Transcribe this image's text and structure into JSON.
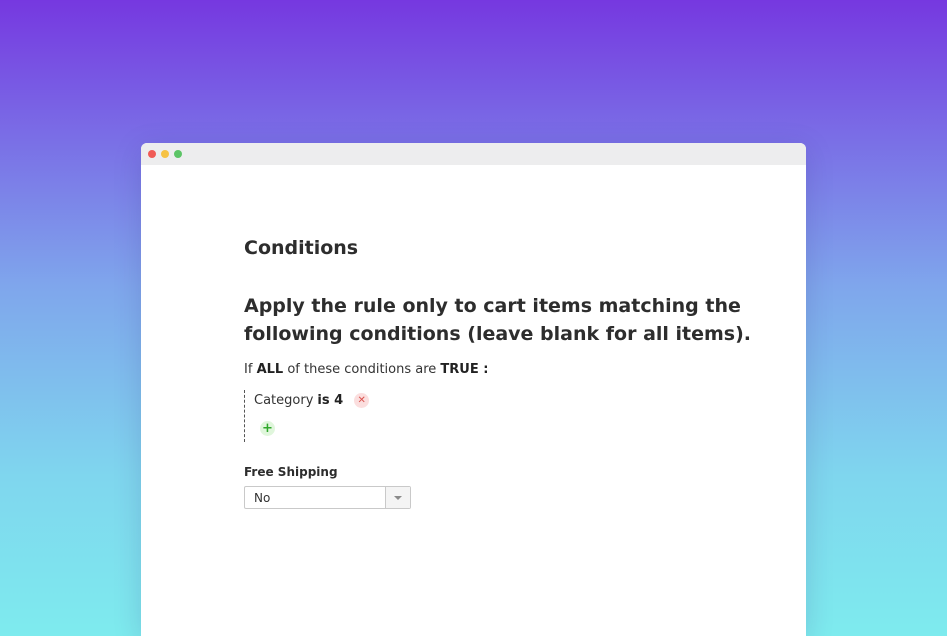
{
  "window": {
    "controls": [
      "close",
      "minimize",
      "maximize"
    ]
  },
  "conditions": {
    "section_title": "Conditions",
    "rule_heading": "Apply the rule only to cart items matching the following conditions (leave blank for all items).",
    "if_prefix": "If",
    "aggregator": "ALL",
    "if_middle": "of these conditions are",
    "value": "TRUE :",
    "items": [
      {
        "attribute": "Category",
        "operator_value": "is 4",
        "remove_icon": "close-icon"
      }
    ],
    "add_icon": "plus-icon"
  },
  "free_shipping": {
    "label": "Free Shipping",
    "selected": "No"
  },
  "colors": {
    "remove": "#d9534f",
    "add": "#2fa82a"
  }
}
